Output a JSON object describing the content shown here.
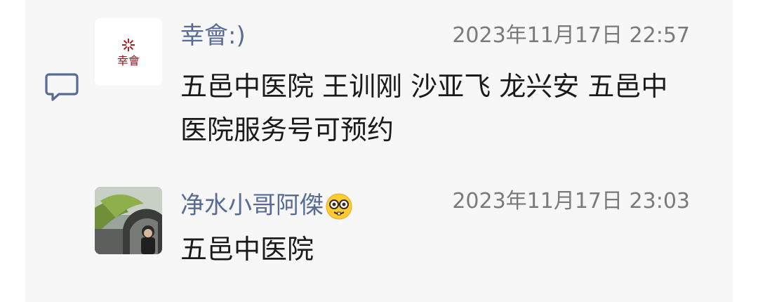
{
  "comments": [
    {
      "author": "幸會:)",
      "avatar_logo_text": "幸會",
      "timestamp": "2023年11月17日 22:57",
      "text": "五邑中医院 王训刚 沙亚飞 龙兴安 五邑中医院服务号可预约"
    },
    {
      "author": "净水小哥阿傑",
      "author_emoji": "nerd-face-emoji",
      "timestamp": "2023年11月17日 23:03",
      "text": "五邑中医院"
    }
  ],
  "colors": {
    "author_name": "#576b95",
    "timestamp": "#7a7a7a",
    "body_text": "#1a1a1a",
    "panel_bg": "#f7f7f7",
    "logo_red": "#b01e2a"
  },
  "icons": {
    "comment_section_icon": "comment-bubble-icon"
  }
}
